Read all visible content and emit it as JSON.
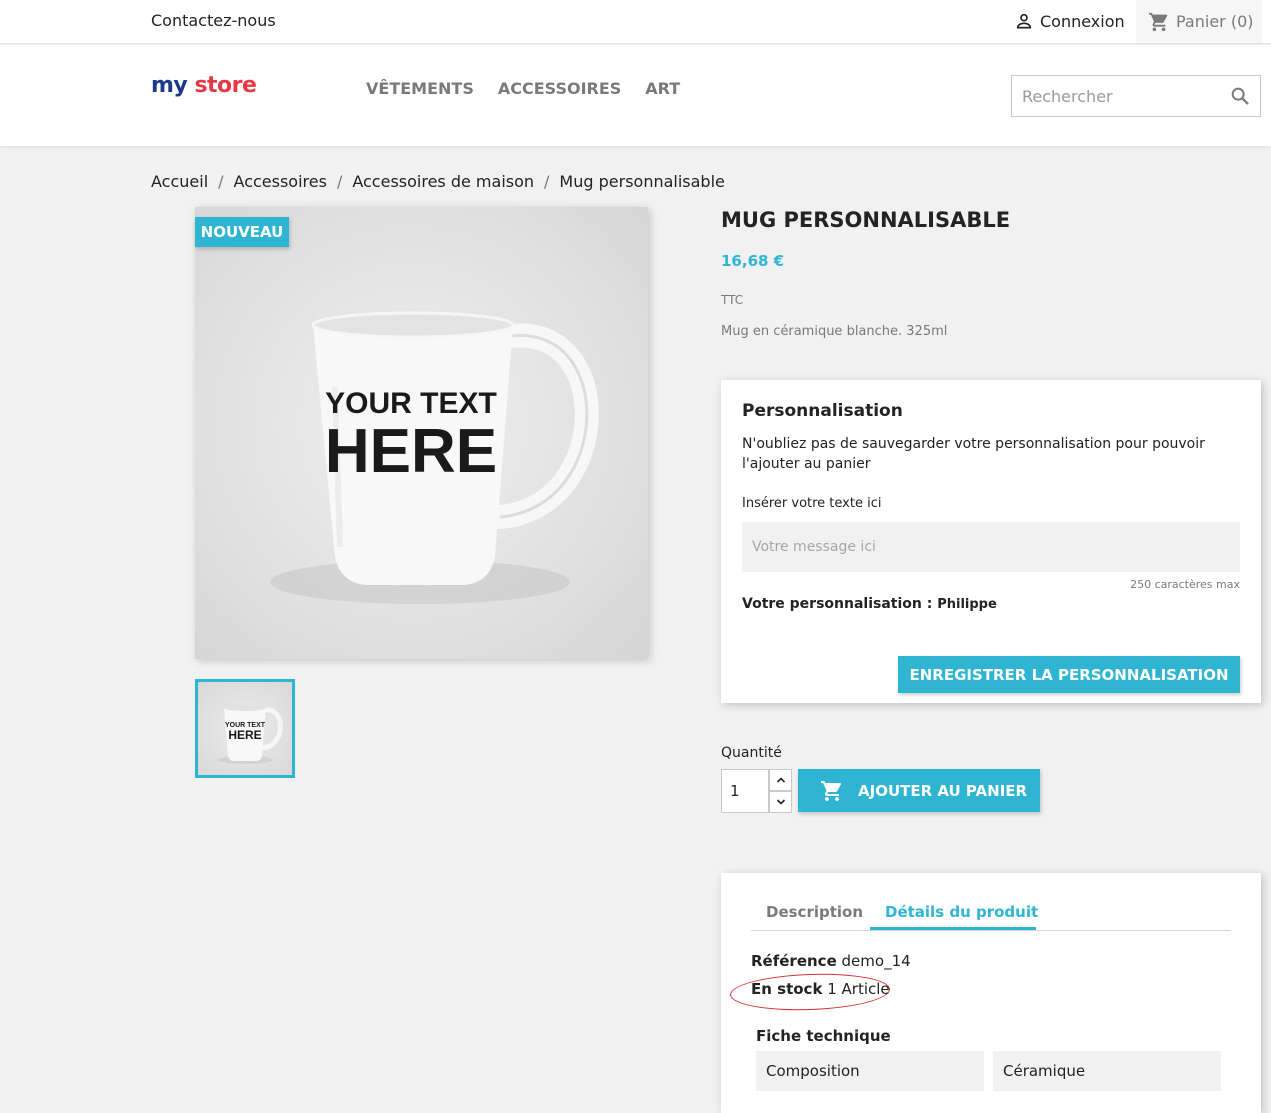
{
  "topbar": {
    "contact": "Contactez-nous",
    "login": "Connexion",
    "cart": "Panier (0)"
  },
  "header": {
    "logo": {
      "part1": "my",
      "part2": "store"
    },
    "nav": [
      "VÊTEMENTS",
      "ACCESSOIRES",
      "ART"
    ],
    "search_placeholder": "Rechercher"
  },
  "breadcrumb": [
    "Accueil",
    "Accessoires",
    "Accessoires de maison",
    "Mug personnalisable"
  ],
  "product": {
    "badge": "NOUVEAU",
    "mug_text_line1": "YOUR TEXT",
    "mug_text_line2": "HERE",
    "title": "MUG PERSONNALISABLE",
    "price": "16,68 €",
    "tax_label": "TTC",
    "short_description": "Mug en céramique blanche. 325ml"
  },
  "customization": {
    "title": "Personnalisation",
    "note": "N'oubliez pas de sauvegarder votre personnalisation pour pouvoir l'ajouter au panier",
    "field_label": "Insérer votre texte ici",
    "placeholder": "Votre message ici",
    "max_chars": "250 caractères max",
    "saved_label": "Votre personnalisation :",
    "saved_value": "Philippe",
    "save_button": "ENREGISTRER LA PERSONNALISATION"
  },
  "purchase": {
    "quantity_label": "Quantité",
    "quantity_value": "1",
    "add_to_cart": "AJOUTER AU PANIER"
  },
  "tabs": {
    "items": [
      "Description",
      "Détails du produit"
    ],
    "active": "Détails du produit",
    "reference_label": "Référence",
    "reference_value": "demo_14",
    "stock_label": "En stock",
    "stock_value": "1 Article",
    "datasheet_title": "Fiche technique",
    "datasheet": [
      {
        "name": "Composition",
        "value": "Céramique"
      }
    ]
  },
  "colors": {
    "accent": "#2fb5d2",
    "annotation": "#d62e2e",
    "logo_colors": [
      "#1e3a8a",
      "#e63946",
      "#2fb5d2",
      "#f4a261"
    ]
  }
}
